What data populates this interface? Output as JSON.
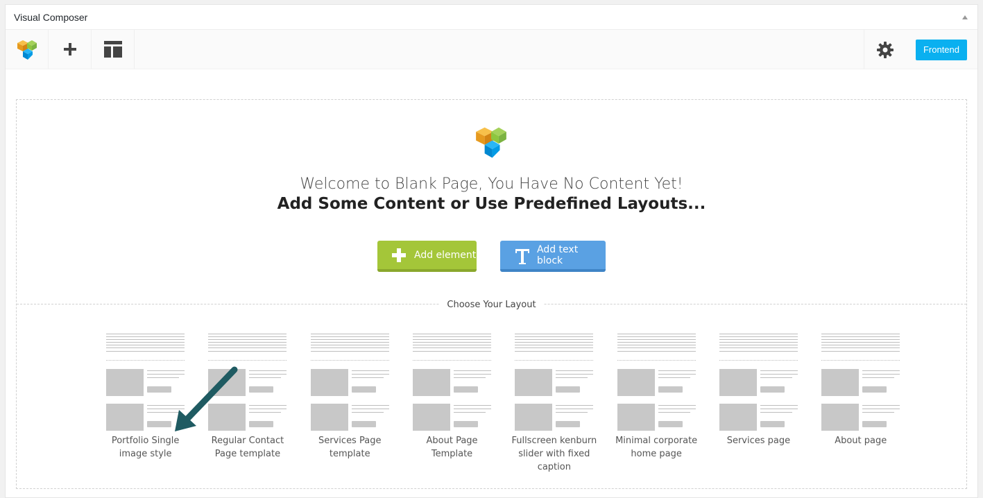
{
  "panel": {
    "title": "Visual Composer"
  },
  "toolbar": {
    "frontend_label": "Frontend"
  },
  "welcome": {
    "line1": "Welcome to Blank Page, You Have No Content Yet!",
    "line2": "Add Some Content or Use Predefined Layouts..."
  },
  "buttons": {
    "add_element": "Add element",
    "add_text_block": "Add text block"
  },
  "layouts": {
    "label": "Choose Your Layout",
    "items": [
      {
        "name": "Portfolio Single image style"
      },
      {
        "name": "Regular Contact Page template"
      },
      {
        "name": "Services Page template"
      },
      {
        "name": "About Page Template"
      },
      {
        "name": "Fullscreen kenburn slider with fixed caption"
      },
      {
        "name": "Minimal corporate home page"
      },
      {
        "name": "Services page"
      },
      {
        "name": "About page"
      }
    ]
  },
  "colors": {
    "frontend_blue": "#0ab0f0",
    "add_element_green": "#a4c639",
    "add_text_blue": "#5aa1e3",
    "arrow_teal": "#1f5b62"
  },
  "icons": [
    "vc-logo-icon",
    "plus-icon",
    "templates-icon",
    "gear-icon",
    "text-t-icon",
    "collapse-arrow-icon"
  ]
}
